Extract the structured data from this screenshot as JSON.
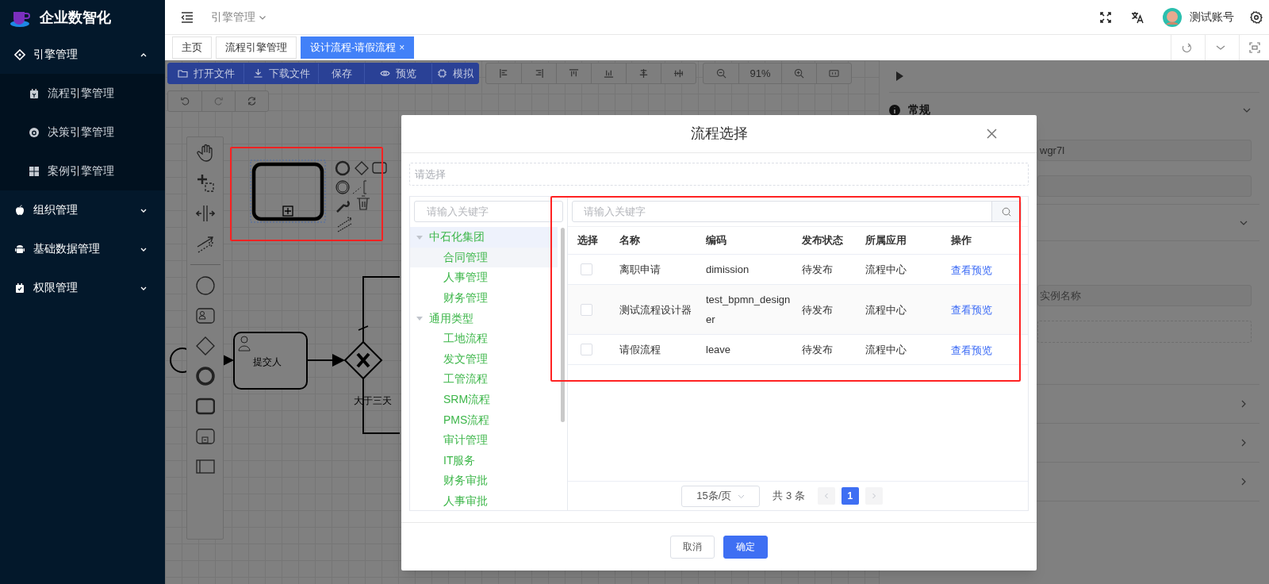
{
  "sidebar": {
    "logo": "企业数智化",
    "menu": [
      {
        "label": "引擎管理",
        "expanded": true,
        "children": [
          {
            "label": "流程引擎管理"
          },
          {
            "label": "决策引擎管理"
          },
          {
            "label": "案例引擎管理"
          }
        ]
      },
      {
        "label": "组织管理",
        "expanded": false
      },
      {
        "label": "基础数据管理",
        "expanded": false
      },
      {
        "label": "权限管理",
        "expanded": false
      }
    ]
  },
  "header": {
    "breadcrumb": "引擎管理",
    "user": "测试账号"
  },
  "tabs": [
    {
      "label": "主页",
      "selected": false
    },
    {
      "label": "流程引擎管理",
      "selected": false
    },
    {
      "label": "设计流程-请假流程",
      "selected": true,
      "close": "×"
    }
  ],
  "toolbar": {
    "file_buttons": [
      "打开文件",
      "下载文件",
      "保存",
      "预览",
      "模拟"
    ],
    "zoom": "91%"
  },
  "diagram": {
    "task_label": "提交人",
    "flow_label": "大于三天"
  },
  "properties": {
    "section": "常规",
    "fields": [
      {
        "kind": "input",
        "value": "wgr7l"
      },
      {
        "kind": "input"
      },
      {
        "kind": "input",
        "placeholder": "实例名称"
      },
      {
        "kind": "dashed"
      }
    ]
  },
  "annotation_frames": [
    {
      "kind": "rectangle"
    },
    {
      "kind": "rectangle"
    }
  ],
  "modal": {
    "title": "流程选择",
    "select_placeholder": "请选择",
    "tree_search_placeholder": "请输入关键字",
    "tree": [
      {
        "label": "中石化集团",
        "expanded": true,
        "selected": true,
        "children": [
          {
            "label": "合同管理",
            "selected": true
          },
          {
            "label": "人事管理",
            "selected": false
          },
          {
            "label": "财务管理",
            "selected": false
          }
        ]
      },
      {
        "label": "通用类型",
        "expanded": true,
        "selected": false,
        "children": [
          {
            "label": "工地流程",
            "selected": false
          },
          {
            "label": "发文管理",
            "selected": false
          },
          {
            "label": "工管流程",
            "selected": false
          },
          {
            "label": "SRM流程",
            "selected": false
          },
          {
            "label": "PMS流程",
            "selected": false
          },
          {
            "label": "审计管理",
            "selected": false
          },
          {
            "label": "IT服务",
            "selected": false
          },
          {
            "label": "财务审批",
            "selected": false
          },
          {
            "label": "人事审批",
            "selected": false
          }
        ]
      }
    ],
    "table_search_placeholder": "请输入关键字",
    "table": {
      "columns": [
        "选择",
        "名称",
        "编码",
        "发布状态",
        "所属应用",
        "操作"
      ],
      "rows": [
        {
          "checked": false,
          "name": "离职申请",
          "code": "dimission",
          "status": "待发布",
          "app": "流程中心",
          "action": "查看预览"
        },
        {
          "checked": false,
          "name": "测试流程设计器",
          "code": "test_bpmn_designer",
          "status": "待发布",
          "app": "流程中心",
          "action": "查看预览"
        },
        {
          "checked": false,
          "name": "请假流程",
          "code": "leave",
          "status": "待发布",
          "app": "流程中心",
          "action": "查看预览"
        }
      ]
    },
    "pagination": {
      "page_size": "15条/页",
      "total": "共 3 条",
      "pages": [
        {
          "label": "1",
          "selected": true
        }
      ]
    },
    "buttons": [
      {
        "label": "取消",
        "kind": "default"
      },
      {
        "label": "确定",
        "kind": "primary"
      }
    ]
  }
}
